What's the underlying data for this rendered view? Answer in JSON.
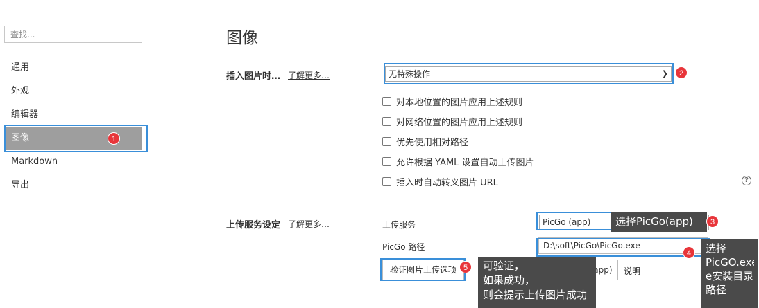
{
  "sidebar": {
    "search_placeholder": "查找...",
    "items": [
      {
        "label": "通用"
      },
      {
        "label": "外观"
      },
      {
        "label": "编辑器"
      },
      {
        "label": "图像"
      },
      {
        "label": "Markdown"
      },
      {
        "label": "导出"
      }
    ],
    "active_index": 3
  },
  "main": {
    "title": "图像",
    "insert": {
      "label": "插入图片时…",
      "learn_more": "了解更多…",
      "select_value": "无特殊操作",
      "checkboxes": [
        {
          "label": "对本地位置的图片应用上述规则",
          "checked": false
        },
        {
          "label": "对网络位置的图片应用上述规则",
          "checked": false
        },
        {
          "label": "优先使用相对路径",
          "checked": false
        },
        {
          "label": "允许根据 YAML 设置自动上传图片",
          "checked": false
        },
        {
          "label": "插入时自动转义图片 URL",
          "checked": false
        }
      ]
    },
    "upload": {
      "label": "上传服务设定",
      "learn_more": "了解更多…",
      "service_label": "上传服务",
      "service_value": "PicGo (app)",
      "path_label": "PicGo 路径",
      "path_value": "D:\\soft\\PicGo\\PicGo.exe",
      "verify_button": "验证图片上传选项",
      "download_button": "下载 PicGo (app)",
      "explain_link": "说明"
    },
    "help_icon": "?"
  },
  "annotations": {
    "badges": [
      "1",
      "2",
      "3",
      "4",
      "5"
    ],
    "tip3": "选择PicGo(app)",
    "tip4": [
      "选择",
      "PicGO.exe",
      "e安装目录",
      "路径"
    ],
    "tip5": [
      "可验证，",
      "如果成功，",
      "则会提示上传图片成功"
    ]
  },
  "colors": {
    "highlight": "#3a8fd9",
    "badge": "#e8353a",
    "active_nav": "#9e9e9e",
    "tooltip": "#4a4a4a"
  }
}
